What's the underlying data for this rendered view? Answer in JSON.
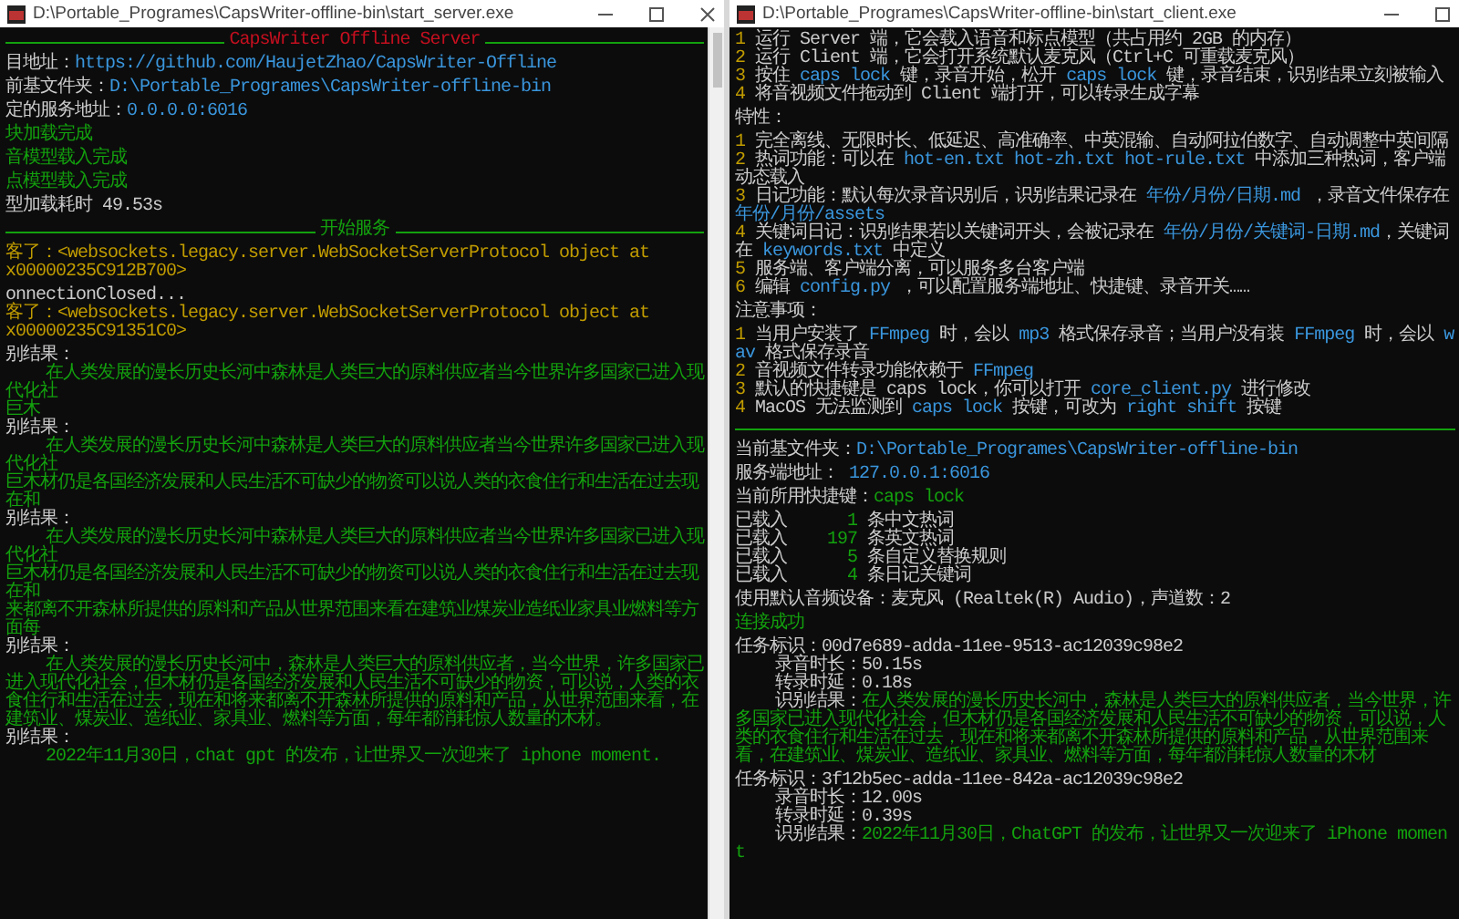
{
  "windows": [
    {
      "title": "D:\\Portable_Programes\\CapsWriter-offline-bin\\start_server.exe",
      "controls": [
        {
          "kind": "minimize"
        },
        {
          "kind": "maximize"
        },
        {
          "kind": "close"
        }
      ],
      "scrollbar": true,
      "blocks": [
        [
          {
            "kind": "rule",
            "label": "CapsWriter Offline Server",
            "color": "#c50f1f"
          }
        ],
        [
          {
            "kind": "text",
            "segments": [
              {
                "text": "目地址：",
                "color": "#cccccc"
              },
              {
                "text": "https://github.com/HaujetZhao/CapsWriter-Offline",
                "color": "#3a96dd"
              }
            ]
          }
        ],
        [
          {
            "kind": "text",
            "segments": [
              {
                "text": "前基文件夹：",
                "color": "#cccccc"
              },
              {
                "text": "D:\\Portable_Programes\\CapsWriter-offline-bin",
                "color": "#3a96dd"
              }
            ]
          }
        ],
        [
          {
            "kind": "text",
            "segments": [
              {
                "text": "定的服务地址：",
                "color": "#cccccc"
              },
              {
                "text": "0.0.0.0:6016",
                "color": "#3a96dd"
              }
            ]
          }
        ],
        [
          {
            "kind": "text",
            "segments": [
              {
                "text": "块加载完成",
                "color": "#13a10e"
              }
            ]
          }
        ],
        [
          {
            "kind": "text",
            "segments": [
              {
                "text": "音模型载入完成",
                "color": "#13a10e"
              }
            ]
          }
        ],
        [
          {
            "kind": "text",
            "segments": [
              {
                "text": "点模型载入完成",
                "color": "#13a10e"
              }
            ]
          }
        ],
        [
          {
            "kind": "text",
            "segments": [
              {
                "text": "型加载耗时 49.53s",
                "color": "#cccccc"
              }
            ]
          }
        ],
        [
          {
            "kind": "rule",
            "label": "开始服务",
            "color": "#13a10e"
          }
        ],
        [
          {
            "kind": "text",
            "segments": [
              {
                "text": "客了：<websockets.legacy.server.WebSocketServerProtocol object at",
                "color": "#c19c00"
              }
            ]
          },
          {
            "kind": "text",
            "segments": [
              {
                "text": "x00000235C912B700>",
                "color": "#c19c00"
              }
            ]
          }
        ],
        [
          {
            "kind": "text",
            "segments": [
              {
                "text": "onnectionClosed...",
                "color": "#cccccc"
              }
            ]
          },
          {
            "kind": "text",
            "segments": [
              {
                "text": "客了：<websockets.legacy.server.WebSocketServerProtocol object at",
                "color": "#c19c00"
              }
            ]
          },
          {
            "kind": "text",
            "segments": [
              {
                "text": "x00000235C91351C0>",
                "color": "#c19c00"
              }
            ]
          }
        ],
        [
          {
            "kind": "text",
            "segments": [
              {
                "text": "别结果：",
                "color": "#cccccc"
              }
            ]
          },
          {
            "kind": "text",
            "segments": [
              {
                "text": "    在人类发展的漫长历史长河中森林是人类巨大的原料供应者当今世界许多国家已进入现代化社",
                "color": "#13a10e"
              }
            ]
          },
          {
            "kind": "text",
            "segments": [
              {
                "text": "巨木",
                "color": "#13a10e"
              }
            ]
          },
          {
            "kind": "text",
            "segments": [
              {
                "text": "别结果：",
                "color": "#cccccc"
              }
            ]
          },
          {
            "kind": "text",
            "segments": [
              {
                "text": "    在人类发展的漫长历史长河中森林是人类巨大的原料供应者当今世界许多国家已进入现代化社",
                "color": "#13a10e"
              }
            ]
          },
          {
            "kind": "text",
            "segments": [
              {
                "text": "巨木材仍是各国经济发展和人民生活不可缺少的物资可以说人类的衣食住行和生活在过去现在和",
                "color": "#13a10e"
              }
            ]
          },
          {
            "kind": "text",
            "segments": [
              {
                "text": "别结果：",
                "color": "#cccccc"
              }
            ]
          },
          {
            "kind": "text",
            "segments": [
              {
                "text": "    在人类发展的漫长历史长河中森林是人类巨大的原料供应者当今世界许多国家已进入现代化社",
                "color": "#13a10e"
              }
            ]
          },
          {
            "kind": "text",
            "segments": [
              {
                "text": "巨木材仍是各国经济发展和人民生活不可缺少的物资可以说人类的衣食住行和生活在过去现在和",
                "color": "#13a10e"
              }
            ]
          },
          {
            "kind": "text",
            "segments": [
              {
                "text": "来都离不开森林所提供的原料和产品从世界范围来看在建筑业煤炭业造纸业家具业燃料等方面每",
                "color": "#13a10e"
              }
            ]
          },
          {
            "kind": "text",
            "segments": [
              {
                "text": "别结果：",
                "color": "#cccccc"
              }
            ]
          },
          {
            "kind": "text",
            "segments": [
              {
                "text": "    在人类发展的漫长历史长河中，森林是人类巨大的原料供应者，当今世界，许多国家已进入现代化社会，但木材仍是各国经济发展和人民生活不可缺少的物资，可以说，人类的衣食住行和生活在过去，现在和将来都离不开森林所提供的原料和产品，从世界范围来看，在建筑业、煤炭业、造纸业、家具业、燃料等方面，每年都消耗惊人数量的木材。",
                "color": "#13a10e"
              }
            ]
          },
          {
            "kind": "text",
            "segments": [
              {
                "text": "别结果：",
                "color": "#cccccc"
              }
            ]
          },
          {
            "kind": "text",
            "segments": [
              {
                "text": "    2022年11月30日，chat gpt 的发布，让世界又一次迎来了 iphone moment.",
                "color": "#13a10e"
              }
            ]
          }
        ]
      ]
    },
    {
      "title": "D:\\Portable_Programes\\CapsWriter-offline-bin\\start_client.exe",
      "controls": [
        {
          "kind": "minimize"
        },
        {
          "kind": "maximize"
        }
      ],
      "scrollbar": false,
      "blocks": [
        [
          {
            "kind": "text",
            "segments": [
              {
                "text": "1",
                "color": "#c19c00"
              },
              {
                "text": " 运行 Server 端，它会载入语音和标点模型（共占用约 2GB 的内存）",
                "color": "#cccccc"
              }
            ]
          },
          {
            "kind": "text",
            "segments": [
              {
                "text": "2",
                "color": "#c19c00"
              },
              {
                "text": " 运行 Client 端，它会打开系统默认麦克风（Ctrl+C 可重载麦克风）",
                "color": "#cccccc"
              }
            ]
          },
          {
            "kind": "text",
            "segments": [
              {
                "text": "3",
                "color": "#c19c00"
              },
              {
                "text": " 按住 ",
                "color": "#cccccc"
              },
              {
                "text": "caps lock",
                "color": "#3a96dd"
              },
              {
                "text": " 键，录音开始，松开 ",
                "color": "#cccccc"
              },
              {
                "text": "caps lock",
                "color": "#3a96dd"
              },
              {
                "text": " 键，录音结束，识别结果立刻被输入",
                "color": "#cccccc"
              }
            ]
          },
          {
            "kind": "text",
            "segments": [
              {
                "text": "4",
                "color": "#c19c00"
              },
              {
                "text": " 将音视频文件拖动到 Client 端打开，可以转录生成字幕",
                "color": "#cccccc"
              }
            ]
          }
        ],
        [
          {
            "kind": "text",
            "segments": [
              {
                "text": "特性：",
                "color": "#cccccc"
              }
            ]
          }
        ],
        [
          {
            "kind": "text",
            "segments": [
              {
                "text": "1",
                "color": "#c19c00"
              },
              {
                "text": " 完全离线、无限时长、低延迟、高准确率、中英混输、自动阿拉伯数字、自动调整中英间隔",
                "color": "#cccccc"
              }
            ]
          },
          {
            "kind": "text",
            "segments": [
              {
                "text": "2",
                "color": "#c19c00"
              },
              {
                "text": " 热词功能：可以在 ",
                "color": "#cccccc"
              },
              {
                "text": "hot-en.txt hot-zh.txt hot-rule.txt",
                "color": "#3a96dd"
              },
              {
                "text": " 中添加三种热词，客户端动态载入",
                "color": "#cccccc"
              }
            ]
          },
          {
            "kind": "text",
            "segments": [
              {
                "text": "3",
                "color": "#c19c00"
              },
              {
                "text": " 日记功能：默认每次录音识别后，识别结果记录在 ",
                "color": "#cccccc"
              },
              {
                "text": "年份/月份/日期.md",
                "color": "#3a96dd"
              },
              {
                "text": " ，录音文件保存在 ",
                "color": "#cccccc"
              },
              {
                "text": "年份/月份/assets",
                "color": "#3a96dd"
              }
            ]
          },
          {
            "kind": "text",
            "segments": [
              {
                "text": "4",
                "color": "#c19c00"
              },
              {
                "text": " 关键词日记：识别结果若以关键词开头，会被记录在 ",
                "color": "#cccccc"
              },
              {
                "text": "年份/月份/关键词-日期.md",
                "color": "#3a96dd"
              },
              {
                "text": "，关键词在 ",
                "color": "#cccccc"
              },
              {
                "text": "keywords.txt",
                "color": "#3a96dd"
              },
              {
                "text": " 中定义",
                "color": "#cccccc"
              }
            ]
          },
          {
            "kind": "text",
            "segments": [
              {
                "text": "5",
                "color": "#c19c00"
              },
              {
                "text": " 服务端、客户端分离，可以服务多台客户端",
                "color": "#cccccc"
              }
            ]
          },
          {
            "kind": "text",
            "segments": [
              {
                "text": "6",
                "color": "#c19c00"
              },
              {
                "text": " 编辑 ",
                "color": "#cccccc"
              },
              {
                "text": "config.py",
                "color": "#3a96dd"
              },
              {
                "text": " ，可以配置服务端地址、快捷键、录音开关……",
                "color": "#cccccc"
              }
            ]
          }
        ],
        [
          {
            "kind": "text",
            "segments": [
              {
                "text": "注意事项：",
                "color": "#cccccc"
              }
            ]
          }
        ],
        [
          {
            "kind": "text",
            "segments": [
              {
                "text": "1",
                "color": "#c19c00"
              },
              {
                "text": " 当用户安装了 ",
                "color": "#cccccc"
              },
              {
                "text": "FFmpeg",
                "color": "#3a96dd"
              },
              {
                "text": " 时，会以 ",
                "color": "#cccccc"
              },
              {
                "text": "mp3",
                "color": "#3a96dd"
              },
              {
                "text": " 格式保存录音；当用户没有装 ",
                "color": "#cccccc"
              },
              {
                "text": "FFmpeg",
                "color": "#3a96dd"
              },
              {
                "text": " 时，会以 ",
                "color": "#cccccc"
              },
              {
                "text": "wav",
                "color": "#3a96dd"
              },
              {
                "text": " 格式保存录音",
                "color": "#cccccc"
              }
            ]
          },
          {
            "kind": "text",
            "segments": [
              {
                "text": "2",
                "color": "#c19c00"
              },
              {
                "text": " 音视频文件转录功能依赖于 ",
                "color": "#cccccc"
              },
              {
                "text": "FFmpeg",
                "color": "#3a96dd"
              }
            ]
          },
          {
            "kind": "text",
            "segments": [
              {
                "text": "3",
                "color": "#c19c00"
              },
              {
                "text": " 默认的快捷键是 caps lock，你可以打开 ",
                "color": "#cccccc"
              },
              {
                "text": "core_client.py",
                "color": "#3a96dd"
              },
              {
                "text": " 进行修改",
                "color": "#cccccc"
              }
            ]
          },
          {
            "kind": "text",
            "segments": [
              {
                "text": "4",
                "color": "#c19c00"
              },
              {
                "text": " MacOS 无法监测到 ",
                "color": "#cccccc"
              },
              {
                "text": "caps lock",
                "color": "#3a96dd"
              },
              {
                "text": " 按键，可改为 ",
                "color": "#cccccc"
              },
              {
                "text": "right shift",
                "color": "#3a96dd"
              },
              {
                "text": " 按键",
                "color": "#cccccc"
              }
            ]
          },
          {
            "kind": "rule",
            "color": "#13a10e"
          }
        ],
        [
          {
            "kind": "text",
            "segments": [
              {
                "text": "当前基文件夹：",
                "color": "#cccccc"
              },
              {
                "text": "D:\\Portable_Programes\\CapsWriter-offline-bin",
                "color": "#3a96dd"
              }
            ]
          }
        ],
        [
          {
            "kind": "text",
            "segments": [
              {
                "text": "服务端地址： ",
                "color": "#cccccc"
              },
              {
                "text": "127.0.0.1:6016",
                "color": "#3a96dd"
              }
            ]
          }
        ],
        [
          {
            "kind": "text",
            "segments": [
              {
                "text": "当前所用快捷键：",
                "color": "#cccccc"
              },
              {
                "text": "caps lock",
                "color": "#13a10e"
              }
            ]
          }
        ],
        [
          {
            "kind": "text",
            "segments": [
              {
                "text": "已载入    ",
                "color": "#cccccc"
              },
              {
                "text": "  1",
                "color": "#13a10e"
              },
              {
                "text": " 条中文热词",
                "color": "#cccccc"
              }
            ]
          },
          {
            "kind": "text",
            "segments": [
              {
                "text": "已载入    ",
                "color": "#cccccc"
              },
              {
                "text": "197",
                "color": "#13a10e"
              },
              {
                "text": " 条英文热词",
                "color": "#cccccc"
              }
            ]
          },
          {
            "kind": "text",
            "segments": [
              {
                "text": "已载入    ",
                "color": "#cccccc"
              },
              {
                "text": "  5",
                "color": "#13a10e"
              },
              {
                "text": " 条自定义替换规则",
                "color": "#cccccc"
              }
            ]
          },
          {
            "kind": "text",
            "segments": [
              {
                "text": "已载入    ",
                "color": "#cccccc"
              },
              {
                "text": "  4",
                "color": "#13a10e"
              },
              {
                "text": " 条日记关键词",
                "color": "#cccccc"
              }
            ]
          }
        ],
        [
          {
            "kind": "text",
            "segments": [
              {
                "text": "使用默认音频设备：麦克风 (Realtek(R) Audio)，声道数：2",
                "color": "#cccccc"
              }
            ]
          }
        ],
        [
          {
            "kind": "text",
            "segments": [
              {
                "text": "连接成功",
                "color": "#13a10e"
              }
            ]
          }
        ],
        [
          {
            "kind": "text",
            "segments": [
              {
                "text": "任务标识：00d7e689-adda-11ee-9513-ac12039c98e2",
                "color": "#cccccc"
              }
            ]
          },
          {
            "kind": "text",
            "segments": [
              {
                "text": "    录音时长：50.15s",
                "color": "#cccccc"
              }
            ]
          },
          {
            "kind": "text",
            "segments": [
              {
                "text": "    转录时延：0.18s",
                "color": "#cccccc"
              }
            ]
          },
          {
            "kind": "text",
            "segments": [
              {
                "text": "    识别结果：",
                "color": "#cccccc"
              },
              {
                "text": "在人类发展的漫长历史长河中，森林是人类巨大的原料供应者，当今世界，许多国家已进入现代化社会，但木材仍是各国经济发展和人民生活不可缺少的物资，可以说，人类的衣食住行和生活在过去，现在和将来都离不开森林所提供的原料和产品，从世界范围来看，在建筑业、煤炭业、造纸业、家具业、燃料等方面，每年都消耗惊人数量的木材",
                "color": "#13a10e"
              }
            ]
          }
        ],
        [
          {
            "kind": "text",
            "segments": [
              {
                "text": "任务标识：3f12b5ec-adda-11ee-842a-ac12039c98e2",
                "color": "#cccccc"
              }
            ]
          },
          {
            "kind": "text",
            "segments": [
              {
                "text": "    录音时长：12.00s",
                "color": "#cccccc"
              }
            ]
          },
          {
            "kind": "text",
            "segments": [
              {
                "text": "    转录时延：0.39s",
                "color": "#cccccc"
              }
            ]
          },
          {
            "kind": "text",
            "segments": [
              {
                "text": "    识别结果：",
                "color": "#cccccc"
              },
              {
                "text": "2022年11月30日，ChatGPT 的发布，让世界又一次迎来了 iPhone moment",
                "color": "#13a10e"
              }
            ]
          }
        ]
      ]
    }
  ]
}
